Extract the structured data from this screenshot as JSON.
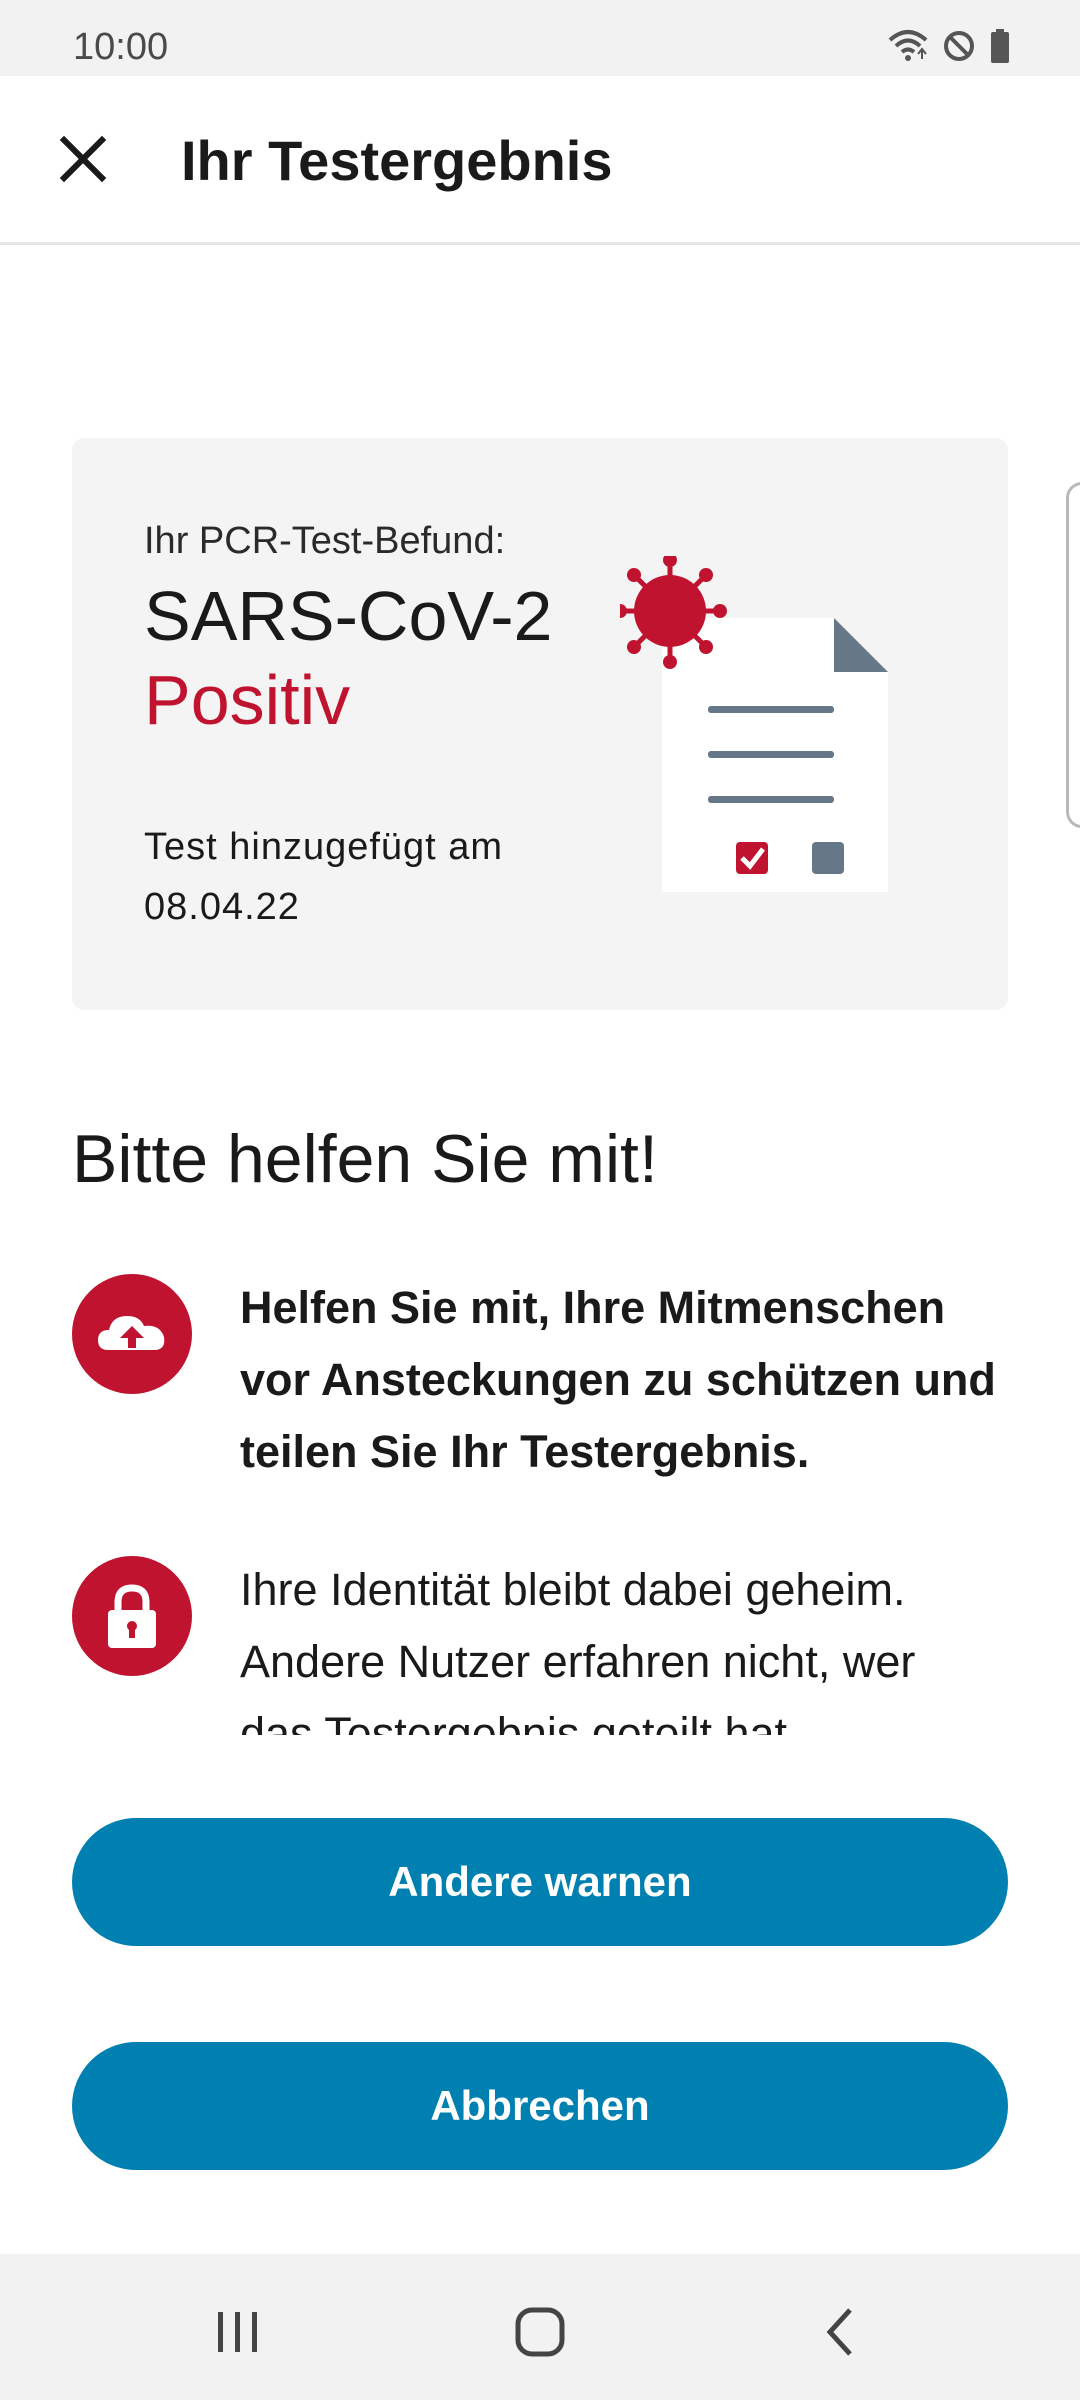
{
  "status_bar": {
    "time": "10:00",
    "icons": [
      "wifi-icon",
      "do-not-disturb-icon",
      "battery-icon"
    ]
  },
  "app_bar": {
    "title": "Ihr Testergebnis",
    "close_icon": "close-icon"
  },
  "result_card": {
    "label": "Ihr PCR-Test-Befund:",
    "disease": "SARS-CoV-2",
    "result": "Positiv",
    "date_label": "Test hinzugefügt am",
    "date": "08.04.22",
    "illustration": "virus-document-illustration"
  },
  "section": {
    "heading": "Bitte helfen Sie mit!",
    "items": [
      {
        "icon": "upload-cloud-icon",
        "line1": "Helfen Sie mit, Ihre Mitmenschen",
        "line2": "vor Ansteckungen zu schützen und",
        "line3": "teilen Sie Ihr Testergebnis."
      },
      {
        "icon": "lock-icon",
        "line1": "Ihre Identität bleibt dabei geheim.",
        "line2": "Andere Nutzer erfahren nicht, wer",
        "line3": "das Testergebnis geteilt hat."
      }
    ]
  },
  "buttons": {
    "warn_label": "Andere warnen",
    "cancel_label": "Abbrechen"
  },
  "colors": {
    "accent_red": "#c0132f",
    "primary_blue": "#0080b0",
    "card_background": "#f4f4f4"
  },
  "nav_bar": {
    "icons": [
      "recent-apps-icon",
      "home-icon",
      "back-icon"
    ]
  }
}
